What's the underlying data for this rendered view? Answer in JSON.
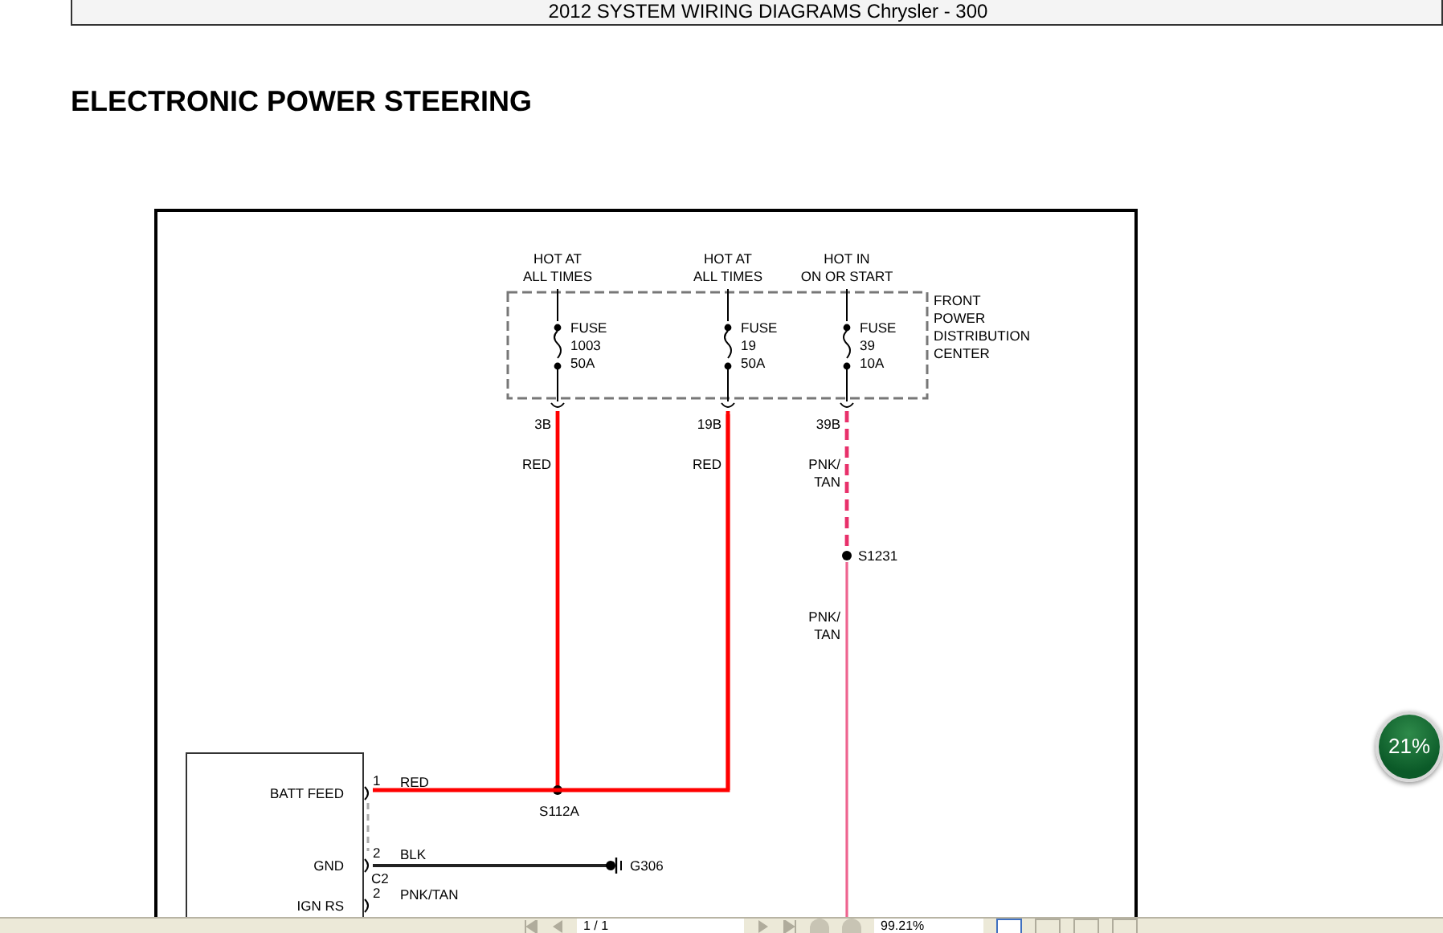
{
  "header": {
    "title": "2012 SYSTEM WIRING DIAGRAMS Chrysler - 300"
  },
  "title": "ELECTRONIC POWER STEERING",
  "diagram": {
    "power_center": {
      "name_lines": [
        "FRONT",
        "POWER",
        "DISTRIBUTION",
        "CENTER"
      ]
    },
    "circuits": [
      {
        "supply": [
          "HOT AT",
          "ALL TIMES"
        ],
        "fuse": [
          "FUSE",
          "1003",
          "50A"
        ],
        "connector": "3B",
        "wire_color": [
          "RED"
        ],
        "kind": "solid",
        "color": "#ff0000",
        "splice": "S112A"
      },
      {
        "supply": [
          "HOT AT",
          "ALL TIMES"
        ],
        "fuse": [
          "FUSE",
          "19",
          "50A"
        ],
        "connector": "19B",
        "wire_color": [
          "RED"
        ],
        "kind": "solid",
        "color": "#ff0000"
      },
      {
        "supply": [
          "HOT IN",
          "ON OR START"
        ],
        "fuse": [
          "FUSE",
          "39",
          "10A"
        ],
        "connector": "39B",
        "wire_color": [
          "PNK/",
          "TAN"
        ],
        "kind": "dashed",
        "color": "#e8306a",
        "splice": "S1231",
        "lower_wire_color": [
          "PNK/",
          "TAN"
        ]
      }
    ],
    "module_pins": [
      {
        "name": "BATT FEED",
        "pin": "1",
        "wire_color": "RED"
      },
      {
        "name": "GND",
        "pin": "2",
        "connector": "C2",
        "wire_color": "BLK"
      },
      {
        "name": "IGN RS",
        "pin": "2",
        "wire_color": "PNK/TAN"
      }
    ],
    "ground": {
      "label": "G306"
    }
  },
  "toolbar": {
    "page": "1 / 1",
    "zoom": "99.21%"
  },
  "progress_badge": {
    "text": "21%"
  }
}
